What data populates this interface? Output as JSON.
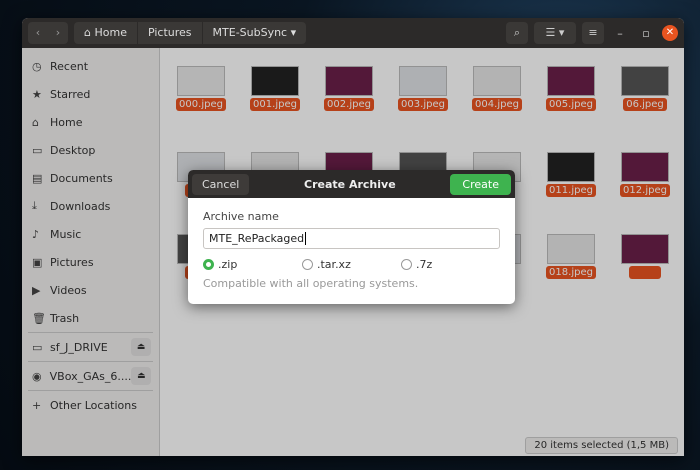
{
  "header": {
    "breadcrumbs": [
      "Home",
      "Pictures",
      "MTE-SubSync"
    ]
  },
  "sidebar": {
    "items": [
      {
        "icon": "clock-icon",
        "glyph": "◷",
        "label": "Recent"
      },
      {
        "icon": "star-icon",
        "glyph": "★",
        "label": "Starred"
      },
      {
        "icon": "home-icon",
        "glyph": "⌂",
        "label": "Home"
      },
      {
        "icon": "folder-icon",
        "glyph": "▭",
        "label": "Desktop"
      },
      {
        "icon": "document-icon",
        "glyph": "▤",
        "label": "Documents"
      },
      {
        "icon": "download-icon",
        "glyph": "⤓",
        "label": "Downloads"
      },
      {
        "icon": "music-icon",
        "glyph": "♪",
        "label": "Music"
      },
      {
        "icon": "picture-icon",
        "glyph": "▣",
        "label": "Pictures"
      },
      {
        "icon": "video-icon",
        "glyph": "▶",
        "label": "Videos"
      },
      {
        "icon": "trash-icon",
        "glyph": "🗑",
        "label": "Trash"
      }
    ],
    "drives": [
      {
        "label": "sf_J_DRIVE"
      },
      {
        "label": "VBox_GAs_6...."
      }
    ],
    "other": "Other Locations"
  },
  "files": [
    "000.jpeg",
    "001.jpeg",
    "002.jpeg",
    "003.jpeg",
    "004.jpeg",
    "005.jpeg",
    "06.jpeg",
    "011.jpeg",
    "012.jpeg",
    "018.jpeg"
  ],
  "status": "20 items selected  (1,5 MB)",
  "dialog": {
    "title": "Create Archive",
    "cancel": "Cancel",
    "create": "Create",
    "name_label": "Archive name",
    "name_value": "MTE_RePackaged",
    "formats": [
      ".zip",
      ".tar.xz",
      ".7z"
    ],
    "hint": "Compatible with all operating systems."
  }
}
